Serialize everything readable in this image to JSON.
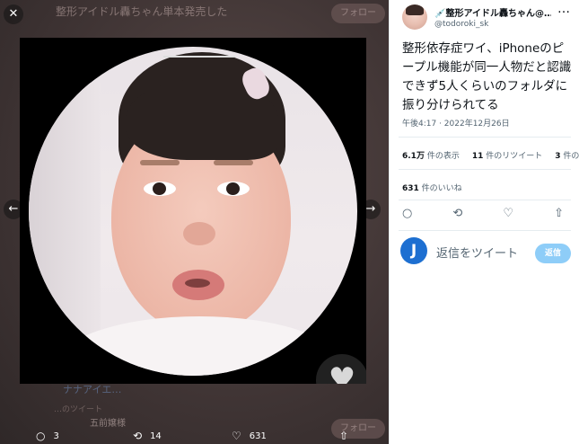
{
  "viewer": {
    "bg_title": "整形アイドル轟ちゃん単本発売した",
    "bg_follow": "フォロー",
    "bg_follow2": "フォロー",
    "bg_link": "ナナアイエ…",
    "bg_small": "…のツイート",
    "bg_name": "五前嬢様",
    "close_glyph": "✕",
    "prev_glyph": "←",
    "next_glyph": "→",
    "heart_glyph": "♥"
  },
  "actionbar": {
    "reply_count": "3",
    "retweet_count": "14",
    "like_count": "631",
    "reply_icon": "○",
    "retweet_icon": "⟲",
    "like_icon": "♡",
    "share_icon": "⇧"
  },
  "tweet": {
    "display_name": "💉整形アイドル轟ちゃん@…",
    "handle": "@todoroki_sk",
    "more_glyph": "…",
    "text": "整形依存症ワイ、iPhoneのピープル機能が同一人物だと認識できず5人くらいのフォルダに振り分けられてる",
    "timestamp": "午後4:17 · 2022年12月26日",
    "views_count": "6.1万",
    "views_label": "件の表示",
    "retweets_count": "11",
    "retweets_label": "件のリツイート",
    "quotes_count": "3",
    "quotes_label": "件の引",
    "likes_count": "631",
    "likes_label": "件のいいね",
    "icons": {
      "reply": "○",
      "retweet": "⟲",
      "like": "♡",
      "share": "⇧"
    }
  },
  "reply": {
    "avatar_letter": "J",
    "placeholder": "返信をツイート",
    "button": "返信"
  },
  "colors": {
    "accent": "#8ecdf8",
    "avatar_bg": "#1d6fd1",
    "viewer_bg": "#463a3a"
  }
}
